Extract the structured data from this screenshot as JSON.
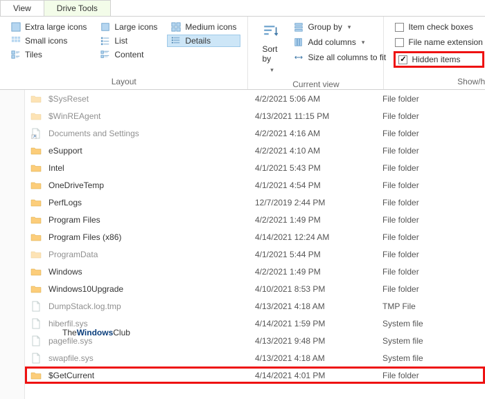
{
  "tabs": {
    "view": "View",
    "drive": "Drive Tools"
  },
  "ribbon": {
    "layout": {
      "label": "Layout",
      "items": {
        "extra_large": "Extra large icons",
        "large": "Large icons",
        "medium": "Medium icons",
        "small": "Small icons",
        "list": "List",
        "details": "Details",
        "tiles": "Tiles",
        "content": "Content"
      }
    },
    "currentview": {
      "label": "Current view",
      "sort": "Sort by",
      "group": "Group by",
      "addcols": "Add columns",
      "sizecols": "Size all columns to fit"
    },
    "showhide": {
      "label": "Show/hi",
      "itemchk": "Item check boxes",
      "fname": "File name extension",
      "hidden": "Hidden items"
    }
  },
  "files": [
    {
      "name": "$SysReset",
      "date": "4/2/2021 5:06 AM",
      "type": "File folder",
      "icon": "folder",
      "shadow": true
    },
    {
      "name": "$WinREAgent",
      "date": "4/13/2021 11:15 PM",
      "type": "File folder",
      "icon": "folder",
      "shadow": true
    },
    {
      "name": "Documents and Settings",
      "date": "4/2/2021 4:16 AM",
      "type": "File folder",
      "icon": "shortcut",
      "shadow": true
    },
    {
      "name": "eSupport",
      "date": "4/2/2021 4:10 AM",
      "type": "File folder",
      "icon": "folder"
    },
    {
      "name": "Intel",
      "date": "4/1/2021 5:43 PM",
      "type": "File folder",
      "icon": "folder"
    },
    {
      "name": "OneDriveTemp",
      "date": "4/1/2021 4:54 PM",
      "type": "File folder",
      "icon": "folder"
    },
    {
      "name": "PerfLogs",
      "date": "12/7/2019 2:44 PM",
      "type": "File folder",
      "icon": "folder"
    },
    {
      "name": "Program Files",
      "date": "4/2/2021 1:49 PM",
      "type": "File folder",
      "icon": "folder"
    },
    {
      "name": "Program Files (x86)",
      "date": "4/14/2021 12:24 AM",
      "type": "File folder",
      "icon": "folder"
    },
    {
      "name": "ProgramData",
      "date": "4/1/2021 5:44 PM",
      "type": "File folder",
      "icon": "folder",
      "shadow": true
    },
    {
      "name": "Windows",
      "date": "4/2/2021 1:49 PM",
      "type": "File folder",
      "icon": "folder"
    },
    {
      "name": "Windows10Upgrade",
      "date": "4/10/2021 8:53 PM",
      "type": "File folder",
      "icon": "folder"
    },
    {
      "name": "DumpStack.log.tmp",
      "date": "4/13/2021 4:18 AM",
      "type": "TMP File",
      "icon": "file",
      "shadow": true
    },
    {
      "name": "hiberfil.sys",
      "date": "4/14/2021 1:59 PM",
      "type": "System file",
      "icon": "file",
      "shadow": true
    },
    {
      "name": "pagefile.sys",
      "date": "4/13/2021 9:48 PM",
      "type": "System file",
      "icon": "file",
      "shadow": true
    },
    {
      "name": "swapfile.sys",
      "date": "4/13/2021 4:18 AM",
      "type": "System file",
      "icon": "file",
      "shadow": true
    },
    {
      "name": "$GetCurrent",
      "date": "4/14/2021 4:01 PM",
      "type": "File folder",
      "icon": "folder",
      "red": true
    }
  ],
  "watermark": {
    "a": "The",
    "b": "Windows",
    "c": "Club"
  }
}
